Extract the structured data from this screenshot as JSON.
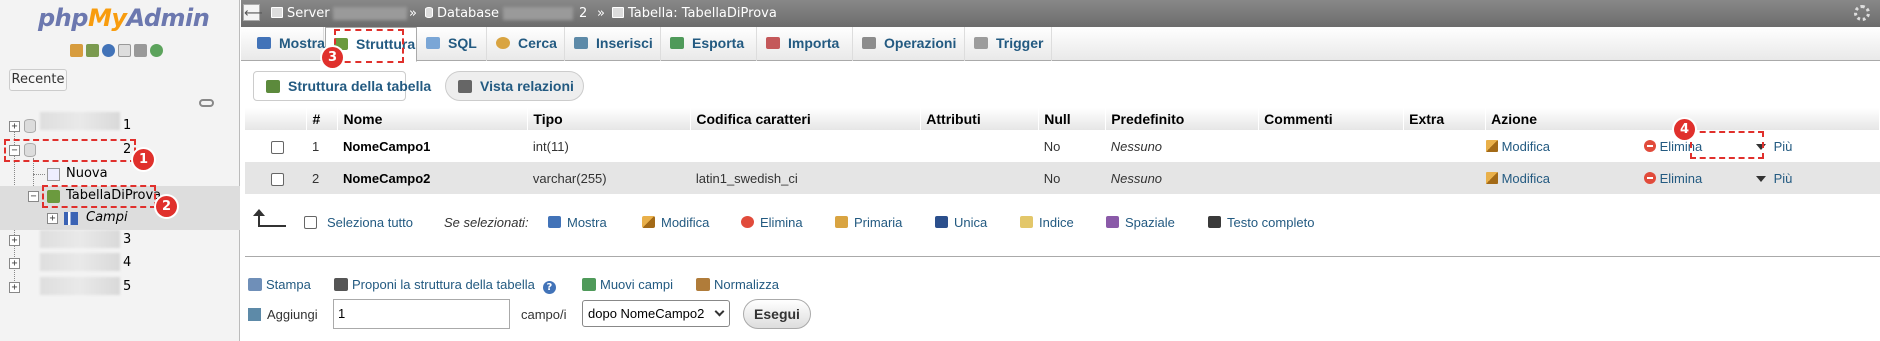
{
  "nav": {
    "logo_php": "php",
    "logo_my": "My",
    "logo_admin": "Admin",
    "recente_label": "Recente",
    "db1_suffix": "1",
    "db2_suffix": "2",
    "new_label": "Nuova",
    "table_label": "TabellaDiProva",
    "columns_label": "Campi",
    "db3_suffix": "3",
    "db4_suffix": "4",
    "db5_suffix": "5"
  },
  "breadcrumb": {
    "server_label": "Server",
    "sep1": "»",
    "database_label": "Database",
    "database_suffix": "2",
    "sep2": "»",
    "table_label": "Tabella: TabellaDiProva"
  },
  "tabs": [
    {
      "label": "Mostra"
    },
    {
      "label": "Struttura"
    },
    {
      "label": "SQL"
    },
    {
      "label": "Cerca"
    },
    {
      "label": "Inserisci"
    },
    {
      "label": "Esporta"
    },
    {
      "label": "Importa"
    },
    {
      "label": "Operazioni"
    },
    {
      "label": "Trigger"
    }
  ],
  "subnav": {
    "struttura_tabella": "Struttura della tabella",
    "vista_relazioni": "Vista relazioni"
  },
  "table": {
    "headers": [
      "#",
      "Nome",
      "Tipo",
      "Codifica caratteri",
      "Attributi",
      "Null",
      "Predefinito",
      "Commenti",
      "Extra",
      "Azione"
    ],
    "rows": [
      {
        "num": "1",
        "nome": "NomeCampo1",
        "tipo": "int(11)",
        "codifica": "",
        "attributi": "",
        "null": "No",
        "predefinito": "Nessuno",
        "commenti": "",
        "extra": "",
        "modifica": "Modifica",
        "elimina": "Elimina",
        "piu": "Più"
      },
      {
        "num": "2",
        "nome": "NomeCampo2",
        "tipo": "varchar(255)",
        "codifica": "latin1_swedish_ci",
        "attributi": "",
        "null": "No",
        "predefinito": "Nessuno",
        "commenti": "",
        "extra": "",
        "modifica": "Modifica",
        "elimina": "Elimina",
        "piu": "Più"
      }
    ]
  },
  "bulk": {
    "select_all": "Seleziona tutto",
    "with_selected": "Se selezionati:",
    "mostra": "Mostra",
    "modifica": "Modifica",
    "elimina": "Elimina",
    "primaria": "Primaria",
    "unica": "Unica",
    "indice": "Indice",
    "spaziale": "Spaziale",
    "testo_completo": "Testo completo"
  },
  "bottom": {
    "stampa": "Stampa",
    "proponi": "Proponi la struttura della tabella",
    "help": "?",
    "muovi": "Muovi campi",
    "normalizza": "Normalizza",
    "aggiungi": "Aggiungi",
    "count_value": "1",
    "campo_label": "campo/i",
    "position_selected": "dopo NomeCampo2",
    "esegui": "Esegui"
  },
  "annotations": [
    "1",
    "2",
    "3",
    "4"
  ],
  "colors": {
    "link": "#235a81",
    "annotation": "#e0302c",
    "row_alt": "#e5e5e5",
    "topbar": "#777777"
  }
}
